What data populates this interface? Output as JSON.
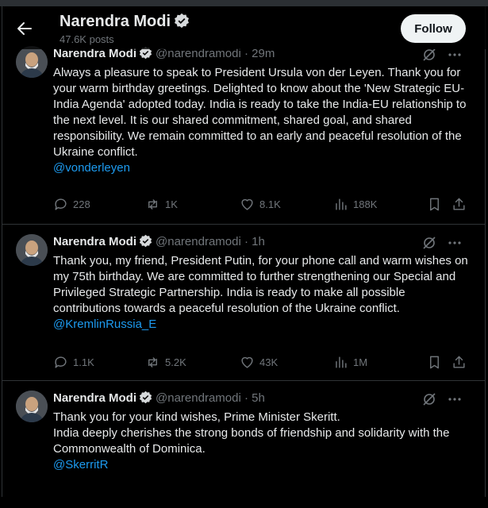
{
  "profile": {
    "name": "Narendra Modi",
    "posts_count": "47.6K posts",
    "follow_label": "Follow"
  },
  "posts": [
    {
      "name": "Narendra Modi",
      "handle": "@narendramodi",
      "dot": "·",
      "time": "29m",
      "text": "Always a pleasure to speak to President Ursula von der Leyen. Thank you for your warm birthday greetings. Delighted to know about the 'New Strategic EU-India Agenda' adopted today. India is ready to take the India-EU relationship to the next level. It is our shared commitment, shared goal, and shared responsibility. We remain committed to an early and peaceful resolution of the Ukraine conflict.",
      "mention": "@vonderleyen",
      "replies": "228",
      "reposts": "1K",
      "likes": "8.1K",
      "views": "188K"
    },
    {
      "name": "Narendra Modi",
      "handle": "@narendramodi",
      "dot": "·",
      "time": "1h",
      "text": "Thank you, my friend, President Putin, for your phone call and warm wishes on my 75th birthday. We are committed to further strengthening our Special and Privileged Strategic Partnership. India is ready to make all possible contributions towards a peaceful resolution of the Ukraine conflict.",
      "mention": "@KremlinRussia_E",
      "replies": "1.1K",
      "reposts": "5.2K",
      "likes": "43K",
      "views": "1M"
    },
    {
      "name": "Narendra Modi",
      "handle": "@narendramodi",
      "dot": "·",
      "time": "5h",
      "text_lines": [
        "Thank you for your kind wishes, Prime Minister Skeritt.",
        "India deeply cherishes the strong bonds of friendship and solidarity with the Commonwealth of Dominica."
      ],
      "mention": "@SkerritR"
    }
  ],
  "icons": {
    "back": "arrow-left-icon",
    "verified": "verified-badge-icon",
    "grok": "grok-icon",
    "more": "more-icon",
    "reply": "reply-icon",
    "repost": "repost-icon",
    "like": "like-icon",
    "views": "views-icon",
    "bookmark": "bookmark-icon",
    "share": "share-icon"
  },
  "colors": {
    "accent": "#1d9bf0",
    "background": "#000000",
    "text": "#e7e9ea",
    "muted": "#71767b",
    "follow_bg": "#eff3f4"
  }
}
